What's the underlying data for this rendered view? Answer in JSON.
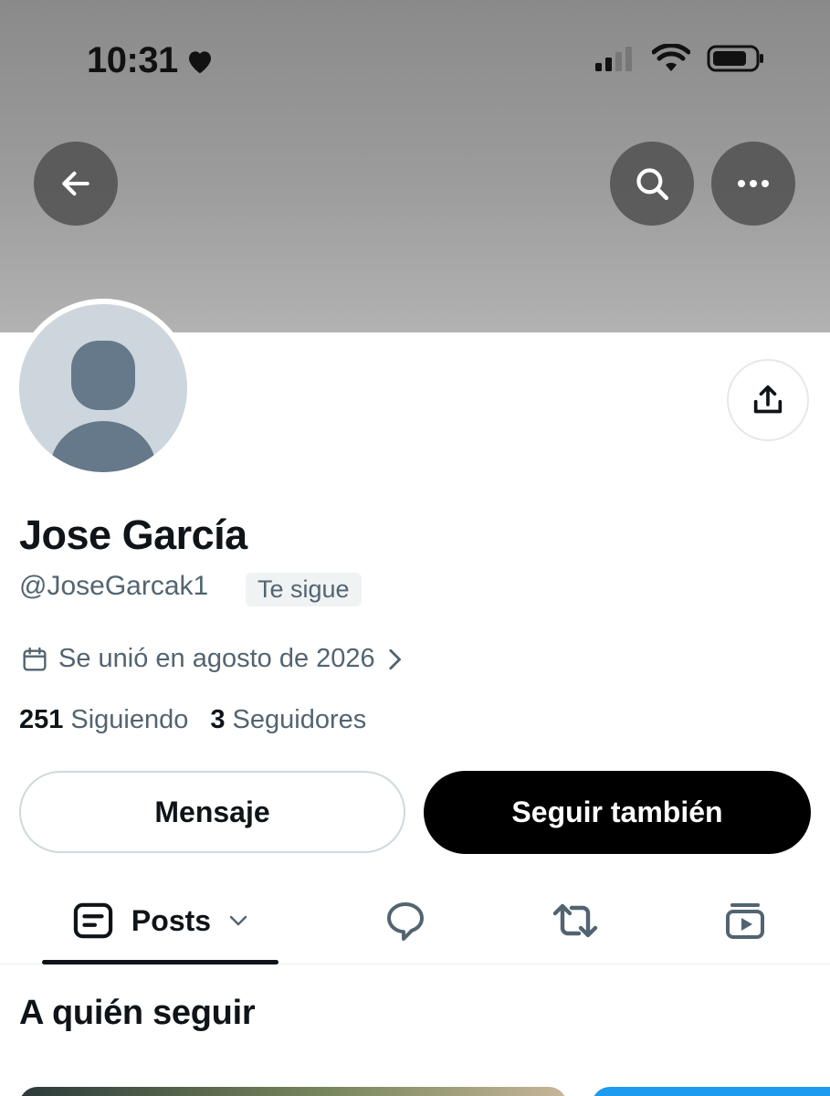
{
  "status_bar": {
    "time": "10:31",
    "icons": [
      "heart-icon",
      "cellular-signal-icon",
      "wifi-icon",
      "battery-icon"
    ]
  },
  "header": {
    "back_icon": "arrow-left-icon",
    "search_icon": "search-icon",
    "more_icon": "more-horizontal-icon"
  },
  "profile": {
    "name": "Jose García",
    "handle": "@JoseGarcak1",
    "follows_you": "Te sigue",
    "joined": "Se unió en agosto de 2026",
    "following_count": "251",
    "following_label": "Siguiendo",
    "followers_count": "3",
    "followers_label": "Seguidores",
    "share_icon": "share-icon"
  },
  "actions": {
    "message_label": "Mensaje",
    "follow_back_label": "Seguir también"
  },
  "tabs": [
    {
      "label": "Posts",
      "icon": "posts-icon",
      "active": true
    },
    {
      "label": "",
      "icon": "replies-icon"
    },
    {
      "label": "",
      "icon": "reposts-icon"
    },
    {
      "label": "",
      "icon": "media-icon"
    }
  ],
  "who_to_follow": {
    "title": "A quién seguir"
  },
  "colors": {
    "text_primary": "#0f1419",
    "text_secondary": "#536471",
    "follow_button_bg": "#000000",
    "border": "#cfd9de",
    "avatar_bg": "#cdd6dc",
    "avatar_fg": "#66798a"
  }
}
